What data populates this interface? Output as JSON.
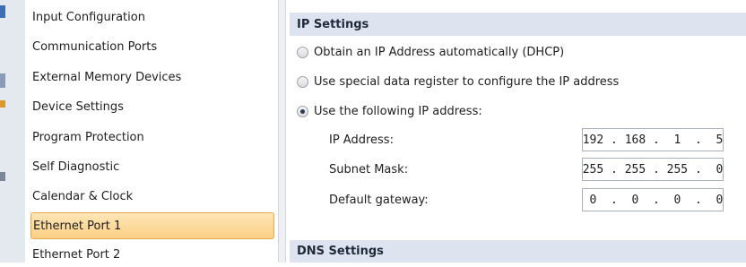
{
  "nav": {
    "items": [
      {
        "label": "Input Configuration"
      },
      {
        "label": "Communication Ports"
      },
      {
        "label": "External Memory Devices"
      },
      {
        "label": "Device Settings"
      },
      {
        "label": "Program Protection"
      },
      {
        "label": "Self Diagnostic"
      },
      {
        "label": "Calendar & Clock"
      },
      {
        "label": "Ethernet Port 1",
        "selected": true
      },
      {
        "label": "Ethernet Port 2"
      }
    ]
  },
  "ip_settings": {
    "title": "IP Settings",
    "options": [
      {
        "label": "Obtain an IP Address automatically (DHCP)",
        "checked": false
      },
      {
        "label": "Use special data register to configure the IP address",
        "checked": false
      },
      {
        "label": "Use the following IP address:",
        "checked": true
      }
    ],
    "fields": [
      {
        "label": "IP Address:",
        "value": "192 . 168 .  1  .  5"
      },
      {
        "label": "Subnet Mask:",
        "value": "255 . 255 . 255 .  0"
      },
      {
        "label": "Default gateway:",
        "value": " 0  .  0  .  0  .  0"
      }
    ]
  },
  "dns_settings": {
    "title": "DNS Settings"
  },
  "colors": {
    "selected_bg": "#fbd086",
    "section_header_bg": "#dde4ef"
  }
}
